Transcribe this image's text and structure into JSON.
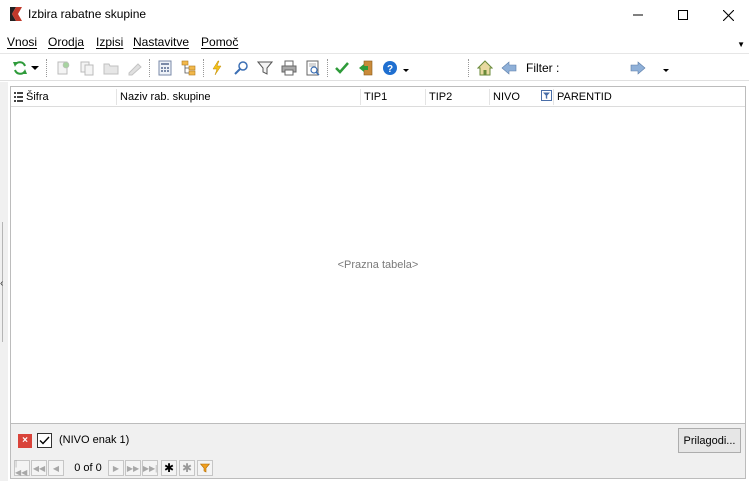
{
  "window": {
    "title": "Izbira rabatne skupine"
  },
  "menu": {
    "items": [
      {
        "underline": "V",
        "rest": "nosi"
      },
      {
        "underline": "O",
        "rest": "rodja"
      },
      {
        "underline": "I",
        "rest": "zpisi"
      },
      {
        "underline": "N",
        "rest": "astavitve"
      },
      {
        "underline": "P",
        "rest": "omoč"
      }
    ]
  },
  "toolbar": {
    "filter_label": "Filter :",
    "icons": [
      "refresh-icon",
      "new-icon",
      "copy-icon",
      "folder-icon",
      "edit-icon",
      "calculator-icon",
      "tree-icon",
      "lightning-icon",
      "search-icon",
      "funnel-icon",
      "print-icon",
      "print-preview-icon",
      "confirm-icon",
      "exit-icon",
      "help-icon",
      "home-icon",
      "back-icon",
      "forward-icon"
    ]
  },
  "grid": {
    "columns": [
      "Šifra",
      "Naziv rab. skupine",
      "TIP1",
      "TIP2",
      "NIVO",
      "PARENTID"
    ],
    "empty_text": "<Prazna tabela>"
  },
  "filterbar": {
    "filter_text": "(NIVO enak 1)",
    "customize_label": "Prilagodi..."
  },
  "navigator": {
    "record_text": "0 of 0"
  },
  "colors": {
    "accent_green": "#2e9b3a",
    "help_blue": "#1f6fd0",
    "filter_x_red": "#d9433a"
  }
}
